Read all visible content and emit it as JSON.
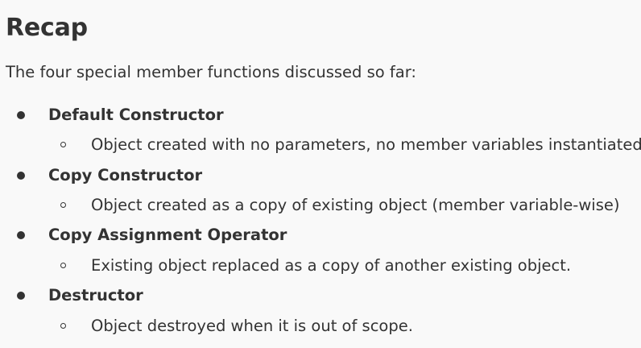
{
  "title": "Recap",
  "intro": "The four special member functions discussed so far:",
  "items": [
    {
      "label": "Default Constructor",
      "detail": "Object created with no parameters, no member variables instantiated"
    },
    {
      "label": "Copy Constructor",
      "detail": "Object created as a copy of existing object (member variable-wise)"
    },
    {
      "label": "Copy Assignment Operator",
      "detail": "Existing object replaced as a copy of another existing object."
    },
    {
      "label": "Destructor",
      "detail": "Object destroyed when it is out of scope."
    }
  ]
}
